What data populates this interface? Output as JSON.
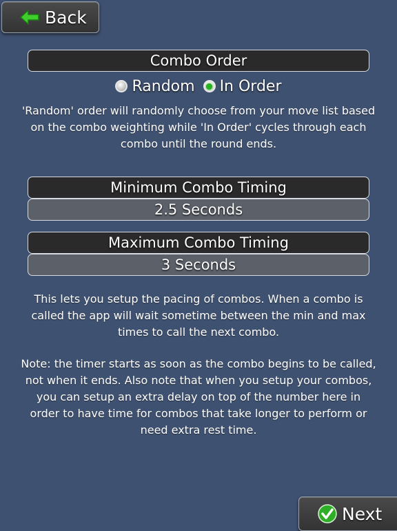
{
  "nav": {
    "back_label": "Back",
    "next_label": "Next"
  },
  "combo_order": {
    "header": "Combo Order",
    "options": [
      {
        "label": "Random",
        "selected": false
      },
      {
        "label": "In Order",
        "selected": true
      }
    ],
    "description": "'Random' order will randomly choose from your move list based on the combo weighting while 'In Order' cycles through each combo until the round ends."
  },
  "min_timing": {
    "header": "Minimum Combo Timing",
    "value": "2.5 Seconds"
  },
  "max_timing": {
    "header": "Maximum Combo Timing",
    "value": "3 Seconds"
  },
  "help": {
    "pacing": "This lets you setup the pacing of combos.  When a combo is called the app will wait sometime between the min and max times to call the next combo.",
    "note": "Note: the timer starts as soon as the combo begins to be called, not when it ends.  Also note that when you setup your combos, you can setup an extra delay on top of the number here in order to have time for combos that take longer to perform or need extra rest time."
  },
  "icons": {
    "back": "arrow-left-icon",
    "next": "checkmark-icon",
    "radio_selected_color": "#27b01f"
  },
  "colors": {
    "background": "#3f5170",
    "header_bar": "#2a2a2a",
    "value_bar": "#5b6069"
  }
}
